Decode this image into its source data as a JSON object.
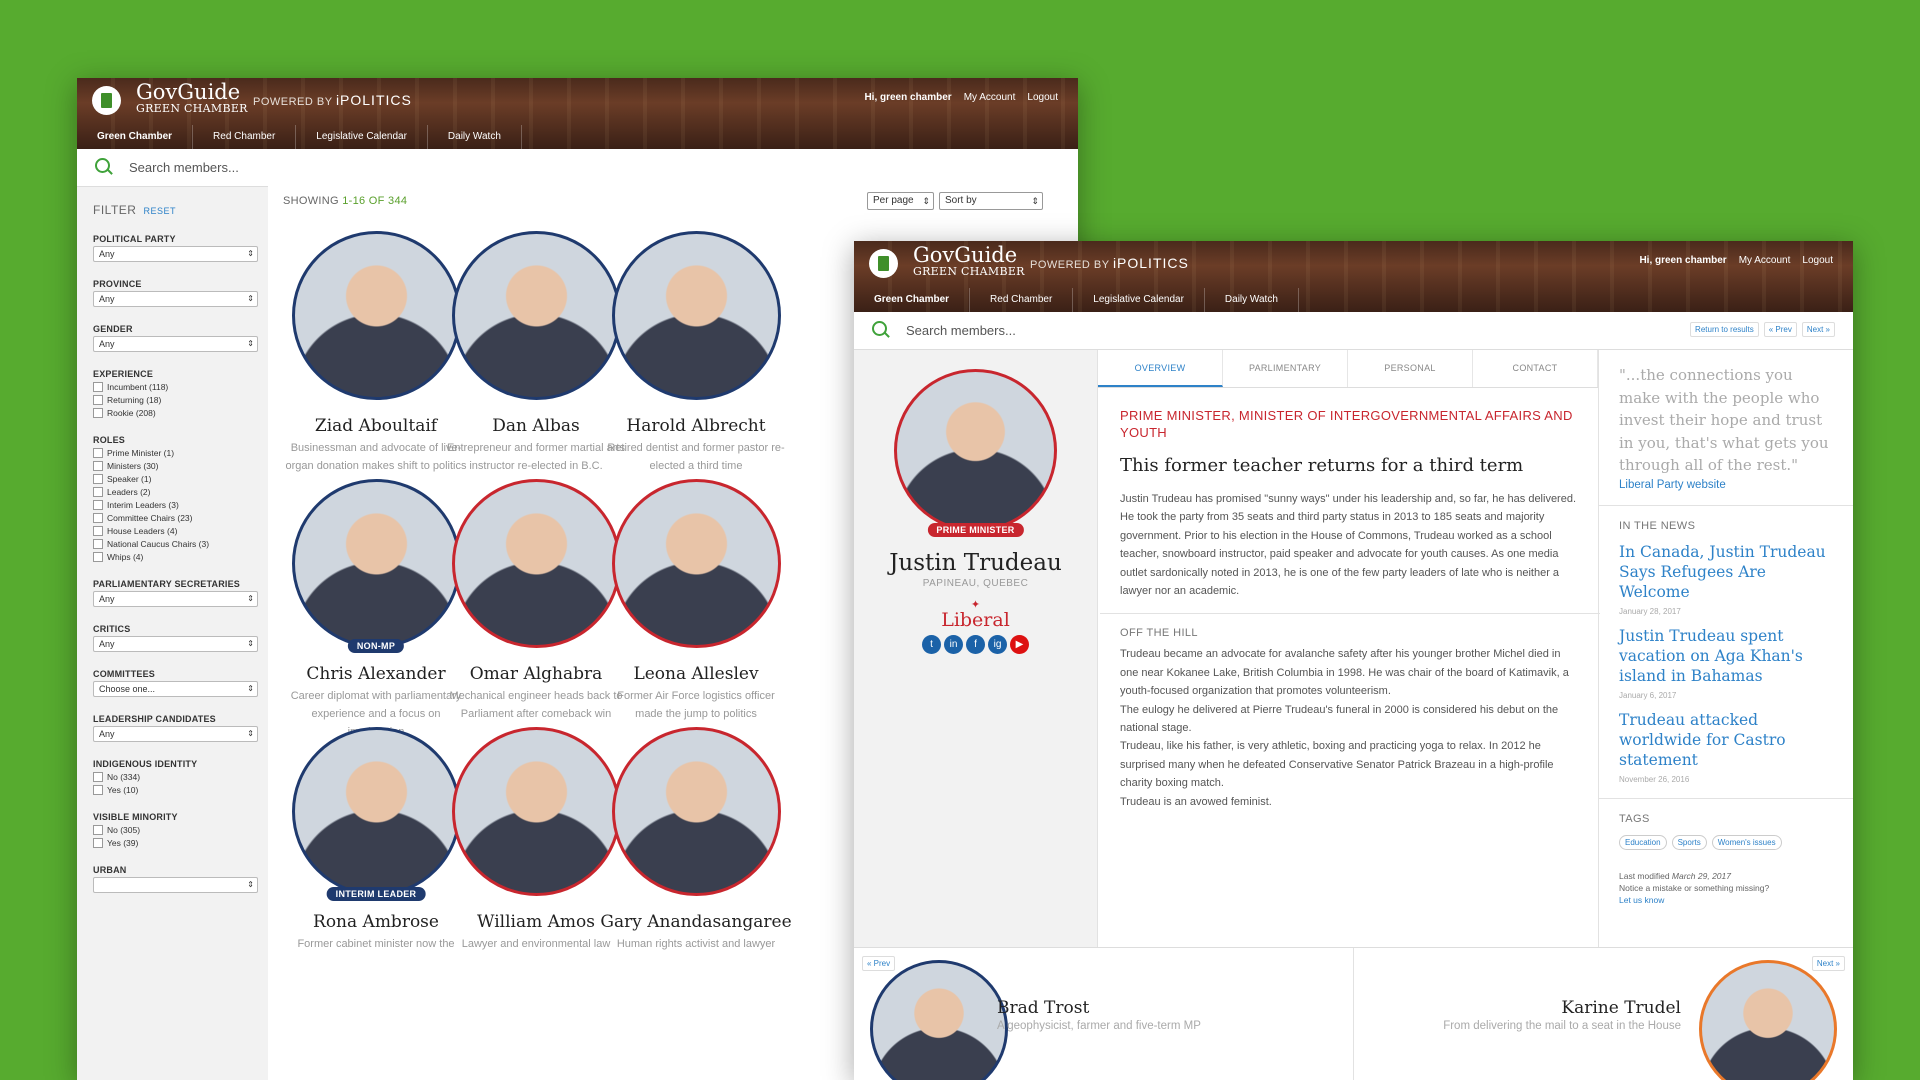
{
  "header": {
    "brand": "GovGuide",
    "brand_sub": "GREEN CHAMBER",
    "powered": "POWERED BY",
    "powered_brand": "iPOLITICS",
    "greeting": "Hi, green chamber",
    "my_account": "My Account",
    "logout": "Logout",
    "nav": [
      "Green Chamber",
      "Red Chamber",
      "Legislative Calendar",
      "Daily Watch"
    ]
  },
  "search": {
    "placeholder": "Search members..."
  },
  "filter": {
    "title": "FILTER",
    "reset": "RESET",
    "political_party": {
      "label": "POLITICAL PARTY",
      "value": "Any"
    },
    "province": {
      "label": "PROVINCE",
      "value": "Any"
    },
    "gender": {
      "label": "GENDER",
      "value": "Any"
    },
    "experience": {
      "label": "EXPERIENCE",
      "options": [
        "Incumbent (118)",
        "Returning (18)",
        "Rookie (208)"
      ]
    },
    "roles": {
      "label": "ROLES",
      "options": [
        "Prime Minister (1)",
        "Ministers (30)",
        "Speaker (1)",
        "Leaders (2)",
        "Interim Leaders (3)",
        "Committee Chairs (23)",
        "House Leaders (4)",
        "National Caucus Chairs (3)",
        "Whips (4)"
      ]
    },
    "parl_secretaries": {
      "label": "PARLIAMENTARY SECRETARIES",
      "value": "Any"
    },
    "critics": {
      "label": "CRITICS",
      "value": "Any"
    },
    "committees": {
      "label": "COMMITTEES",
      "value": "Choose one..."
    },
    "leadership": {
      "label": "LEADERSHIP CANDIDATES",
      "value": "Any"
    },
    "indigenous": {
      "label": "INDIGENOUS IDENTITY",
      "options": [
        "No (334)",
        "Yes (10)"
      ]
    },
    "minority": {
      "label": "VISIBLE MINORITY",
      "options": [
        "No (305)",
        "Yes (39)"
      ]
    },
    "urban": {
      "label": "URBAN"
    }
  },
  "listing": {
    "showing_prefix": "SHOWING ",
    "showing_range": "1-16 OF 344",
    "per_page": "Per page",
    "sort_by": "Sort by",
    "members": [
      {
        "name": "Ziad Aboultaif",
        "desc": "Businessman and advocate of live-organ donation makes shift to politics",
        "tag": "",
        "border": "blue"
      },
      {
        "name": "Dan Albas",
        "desc": "Entrepreneur and former martial arts instructor re-elected in B.C.",
        "tag": "",
        "border": "blue"
      },
      {
        "name": "Harold Albrecht",
        "desc": "Retired dentist and former pastor re-elected a third time",
        "tag": "",
        "border": "blue"
      },
      {
        "name": "Chris Alexander",
        "desc": "Career diplomat with parliamentary experience and a focus on immigration",
        "tag": "NON-MP",
        "border": "blue"
      },
      {
        "name": "Omar Alghabra",
        "desc": "Mechanical engineer heads back to Parliament after comeback win",
        "tag": "",
        "border": "red"
      },
      {
        "name": "Leona Alleslev",
        "desc": "Former Air Force logistics officer made the jump to politics",
        "tag": "",
        "border": "red"
      },
      {
        "name": "Rona Ambrose",
        "desc": "Former cabinet minister now the",
        "tag": "INTERIM LEADER",
        "border": "blue"
      },
      {
        "name": "William Amos",
        "desc": "Lawyer and environmental law",
        "tag": "",
        "border": "red"
      },
      {
        "name": "Gary Anandasangaree",
        "desc": "Human rights activist and lawyer",
        "tag": "",
        "border": "red"
      }
    ]
  },
  "profile": {
    "return": "Return to results",
    "prev": "« Prev",
    "next": "Next »",
    "tabs": [
      "OVERVIEW",
      "PARLIMENTARY",
      "PERSONAL",
      "CONTACT"
    ],
    "badge": "PRIME MINISTER",
    "name": "Justin Trudeau",
    "riding": "PAPINEAU, QUEBEC",
    "party": "Liberal",
    "social": [
      "t",
      "in",
      "f",
      "ig",
      "▶"
    ],
    "role": "PRIME MINISTER, MINISTER OF INTERGOVERNMENTAL AFFAIRS AND YOUTH",
    "headline": "This former teacher returns for a third term",
    "overview": "Justin Trudeau has promised \"sunny ways\" under his leadership and, so far, he has delivered. He took the party from 35 seats and third party status in 2013 to 185 seats and majority government. Prior to his election in the House of Commons, Trudeau worked as a school teacher, snowboard instructor, paid speaker and advocate for youth causes. As one media outlet sardonically noted in 2013, he is one of the few party leaders of late who is neither a lawyer nor an academic.",
    "off_hill_title": "OFF THE HILL",
    "off_hill": [
      "Trudeau became an advocate for avalanche safety after his younger brother Michel died in one near Kokanee Lake, British Columbia in 1998. He was chair of the board of Katimavik, a youth-focused organization that promotes volunteerism.",
      "The eulogy he delivered at Pierre Trudeau's funeral in 2000 is considered his debut on the national stage.",
      "Trudeau, like his father, is very athletic, boxing and practicing yoga to relax. In 2012 he surprised many when he defeated Conservative Senator Patrick Brazeau in a high-profile charity boxing match.",
      "Trudeau is an avowed feminist."
    ],
    "quote": "\"...the connections you make with the people who invest their hope and trust in you, that's what gets you through all of the rest.\"",
    "quote_link": "Liberal Party website",
    "news_title": "IN THE NEWS",
    "news": [
      {
        "title": "In Canada, Justin Trudeau Says Refugees Are Welcome",
        "date": "January 28, 2017"
      },
      {
        "title": "Justin Trudeau spent vacation on Aga Khan's island in Bahamas",
        "date": "January 6, 2017"
      },
      {
        "title": "Trudeau attacked worldwide for Castro statement",
        "date": "November 26, 2016"
      }
    ],
    "tags_title": "TAGS",
    "tags": [
      "Education",
      "Sports",
      "Women's issues"
    ],
    "modified_prefix": "Last modified ",
    "modified_date": "March 29, 2017",
    "mistake": "Notice a mistake or something missing?",
    "let_us_know": "Let us know",
    "prev_member": {
      "name": "Brad Trost",
      "desc": "A geophysicist, farmer and five-term MP"
    },
    "next_member": {
      "name": "Karine Trudel",
      "desc": "From delivering the mail to a seat in the House"
    }
  }
}
